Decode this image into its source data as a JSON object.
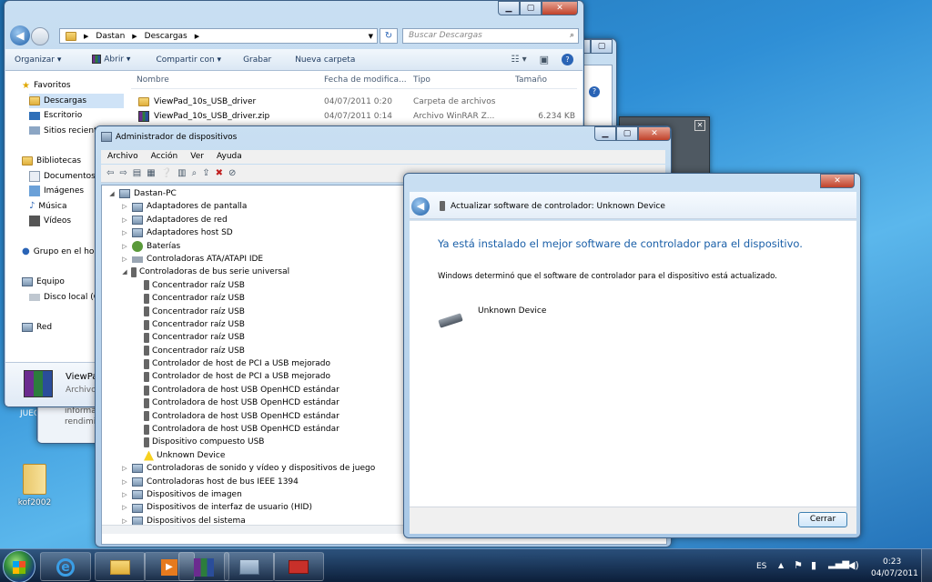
{
  "explorer": {
    "breadcrumb": [
      "Dastan",
      "Descargas"
    ],
    "search_placeholder": "Buscar Descargas",
    "toolbar": [
      "Organizar",
      "Abrir",
      "Compartir con",
      "Grabar",
      "Nueva carpeta"
    ],
    "columns": [
      "Nombre",
      "Fecha de modifica...",
      "Tipo",
      "Tamaño"
    ],
    "sidebar": [
      "Favoritos",
      "Descargas",
      "Escritorio",
      "Sitios reciente",
      "Bibliotecas",
      "Documentos",
      "Imágenes",
      "Música",
      "Vídeos",
      "Grupo en el ho",
      "Equipo",
      "Disco local (C",
      "Red"
    ],
    "files": [
      {
        "name": "ViewPad_10s_USB_driver",
        "date": "04/07/2011 0:20",
        "type": "Carpeta de archivos",
        "size": ""
      },
      {
        "name": "ViewPad_10s_USB_driver.zip",
        "date": "04/07/2011 0:14",
        "type": "Archivo WinRAR Z...",
        "size": "6.234 KB"
      }
    ],
    "details_name": "ViewPad",
    "details_sub": "Archivo"
  },
  "behind_window": {
    "line1": "informa",
    "line2": "rendimi"
  },
  "desktop": {
    "jue_label": "JUEG",
    "folder_label": "kof2002"
  },
  "devmgr": {
    "title": "Administrador de dispositivos",
    "menu": [
      "Archivo",
      "Acción",
      "Ver",
      "Ayuda"
    ],
    "root": "Dastan-PC",
    "categories_before": [
      "Adaptadores de pantalla",
      "Adaptadores de red",
      "Adaptadores host SD",
      "Baterías",
      "Controladoras ATA/ATAPI IDE"
    ],
    "usb_category": "Controladoras de bus serie universal",
    "usb_children": [
      "Concentrador raíz USB",
      "Concentrador raíz USB",
      "Concentrador raíz USB",
      "Concentrador raíz USB",
      "Concentrador raíz USB",
      "Concentrador raíz USB",
      "Controlador de host de PCI a USB mejorado",
      "Controlador de host de PCI a USB mejorado",
      "Controladora de host USB OpenHCD estándar",
      "Controladora de host USB OpenHCD estándar",
      "Controladora de host USB OpenHCD estándar",
      "Controladora de host USB OpenHCD estándar",
      "Dispositivo compuesto USB",
      "Unknown Device"
    ],
    "categories_after": [
      "Controladoras de sonido y vídeo y dispositivos de juego",
      "Controladoras host de bus IEEE 1394",
      "Dispositivos de imagen",
      "Dispositivos de interfaz de usuario (HID)",
      "Dispositivos del sistema"
    ]
  },
  "dialog": {
    "title": "Actualizar software de controlador: Unknown Device",
    "heading": "Ya está instalado el mejor software de controlador para el dispositivo.",
    "message": "Windows determinó que el software de controlador para el dispositivo está actualizado.",
    "device": "Unknown Device",
    "close_button": "Cerrar",
    "accent": "#1a5fa8"
  },
  "tray": {
    "lang": "ES",
    "time": "0:23",
    "date": "04/07/2011"
  }
}
